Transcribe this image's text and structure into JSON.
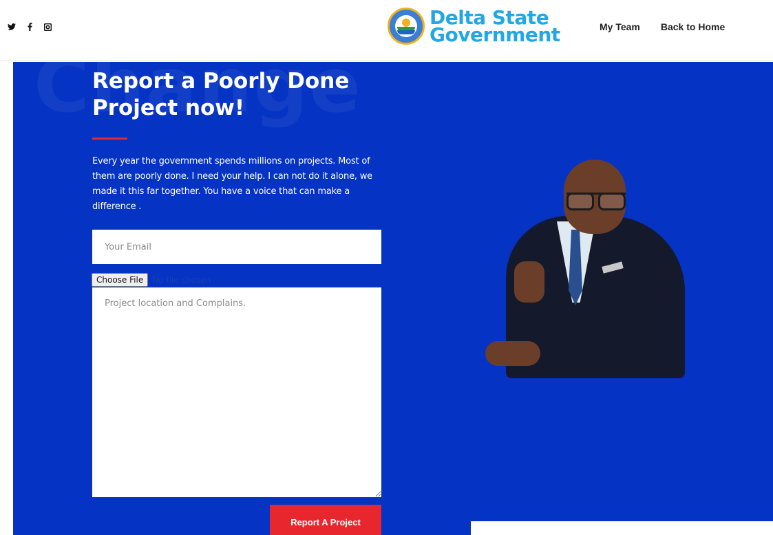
{
  "header": {
    "social": [
      "twitter-icon",
      "facebook-icon",
      "instagram-icon"
    ],
    "logo": {
      "line1": "Delta State",
      "line2": "Government"
    },
    "nav": {
      "my_team": "My Team",
      "back_home": "Back to Home"
    }
  },
  "hero": {
    "watermark": "Change",
    "title_line1": "Report a Poorly Done",
    "title_line2": "Project now!",
    "intro": "Every year the government spends millions on projects. Most of them are poorly done. I need your help. I can not do it alone, we made it this far together. You have a voice that can make a difference .",
    "form": {
      "email_placeholder": "Your Email",
      "file_button": "Choose File",
      "file_status": "No file chosen",
      "complaint_placeholder": "Project location and Complains.",
      "submit_label": "Report A Project"
    }
  },
  "colors": {
    "hero_bg": "#0533c4",
    "accent_red": "#e8262d",
    "logo_blue": "#22a7e6"
  }
}
